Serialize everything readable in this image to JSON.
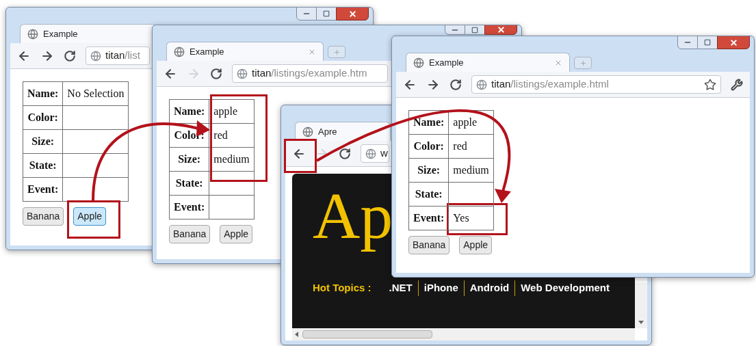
{
  "windows": [
    {
      "kind": "example",
      "tab_title": "Example",
      "forward_disabled": false,
      "address": {
        "host": "titan",
        "path": "/list"
      },
      "table": [
        {
          "label": "Name:",
          "value": "No Selection"
        },
        {
          "label": "Color:"
        },
        {
          "label": "Size:"
        },
        {
          "label": "State:"
        },
        {
          "label": "Event:"
        }
      ],
      "buttons": [
        {
          "label": "Banana",
          "focused": false
        },
        {
          "label": "Apple",
          "focused": true
        }
      ]
    },
    {
      "kind": "example",
      "tab_title": "Example",
      "forward_disabled": true,
      "address": {
        "host": "titan",
        "path": "/listings/example.htm"
      },
      "table": [
        {
          "label": "Name:",
          "value": "apple"
        },
        {
          "label": "Color:",
          "value": "red"
        },
        {
          "label": "Size:",
          "value": "medium"
        },
        {
          "label": "State:"
        },
        {
          "label": "Event:"
        }
      ],
      "buttons": [
        {
          "label": "Banana",
          "focused": false
        },
        {
          "label": "Apple",
          "focused": false
        }
      ]
    },
    {
      "kind": "site",
      "tab_title": "Apre",
      "forward_disabled": true,
      "address": {
        "host": "w"
      },
      "page": {
        "logo_text": "Ap",
        "hot_topics_label": "Hot Topics :",
        "topics": [
          ".NET",
          "iPhone",
          "Android",
          "Web Development"
        ]
      }
    },
    {
      "kind": "example",
      "tab_title": "Example",
      "forward_disabled": false,
      "address": {
        "host": "titan",
        "path": "/listings/example.html"
      },
      "table": [
        {
          "label": "Name:",
          "value": "apple"
        },
        {
          "label": "Color:",
          "value": "red"
        },
        {
          "label": "Size:",
          "value": "medium"
        },
        {
          "label": "State:"
        },
        {
          "label": "Event:",
          "value": "Yes"
        }
      ],
      "buttons": [
        {
          "label": "Banana",
          "focused": false
        },
        {
          "label": "Apple",
          "focused": false
        }
      ]
    }
  ]
}
